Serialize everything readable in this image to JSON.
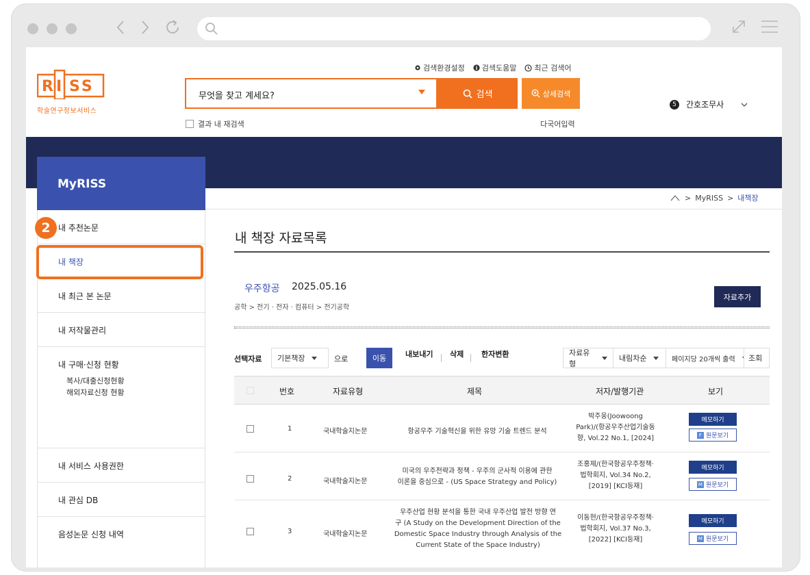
{
  "browser": {
    "url": ""
  },
  "header": {
    "logo_text": "RISS",
    "logo_caption": "학술연구정보서비스",
    "top_links": [
      "검색환경설정",
      "검색도움말",
      "최근 검색어"
    ],
    "search_placeholder": "무엇을 찾고 계세요?",
    "search_button": "검색",
    "detail_button": "상세검색",
    "result_search": "결과 내 재검색",
    "multi_lang": "다국어입력",
    "user_badge": "5",
    "user_name": "간호조무사"
  },
  "myriss": {
    "title": "MyRISS"
  },
  "breadcrumb": {
    "mid": "MyRISS",
    "current": "내책장"
  },
  "annotation": {
    "step": "2"
  },
  "sidebar": {
    "items": [
      {
        "label": "내 추천논문"
      },
      {
        "label": "내 책장"
      },
      {
        "label": "내 최근 본 논문"
      },
      {
        "label": "내 저작물관리"
      },
      {
        "label": "내 구매·신청 현황",
        "subs": [
          "복사/대출신청현황",
          "해외자료신청 현황"
        ]
      },
      {
        "label": "내 서비스 사용권한"
      },
      {
        "label": "내 관심 DB"
      },
      {
        "label": "음성논문 신청 내역"
      }
    ]
  },
  "content": {
    "title": "내 책장 자료목록",
    "shelf_name": "우주항공",
    "shelf_date": "2025.05.16",
    "shelf_category": "공학 > 전기 · 전자 · 컴퓨터 > 전기공학",
    "add_button": "자료추가"
  },
  "toolbar": {
    "label": "선택자료",
    "shelf_select": "기본책장",
    "to_text": "으로",
    "move": "이동",
    "export": "내보내기",
    "delete": "삭제",
    "hanja": "한자변환",
    "type_select": "자료유형",
    "sort_select": "내림차순",
    "per_page_select": "페이지당 20개씩 출력",
    "query": "조회"
  },
  "table": {
    "headers": [
      "번호",
      "자료유형",
      "제목",
      "저자/발행기관",
      "보기"
    ],
    "memo_label": "메모하기",
    "rows": [
      {
        "num": "1",
        "type": "국내학술지논문",
        "title": [
          "항공우주 기술혁신을 위한 유망 기술 트렌드 분석"
        ],
        "author": [
          "박주웅(Joowoong",
          "Park)/(항공우주산업기술동",
          "향, Vol.22 No.1, [2024]"
        ],
        "view_icon": "F",
        "view_label": "원문보기"
      },
      {
        "num": "2",
        "type": "국내학술지논문",
        "title": [
          "미국의 우주전략과 정책 - 우주의 군사적 이용에 관한",
          "이론을 중심으로 - (US Space Strategy and Policy)"
        ],
        "author": [
          "조홍제/(한국항공우주정책·",
          "법학회지, Vol.34 No.2,",
          "[2019] [KCI등재]"
        ],
        "view_icon": "M",
        "view_label": "원문보기"
      },
      {
        "num": "3",
        "type": "국내학술지논문",
        "title": [
          "우주산업 현황 분석을 통한 국내 우주산업 발전 방향 연",
          "구 (A Study on the Development Direction of the",
          "Domestic Space Industry through Analysis of the",
          "Current State of the Space Industry)"
        ],
        "author": [
          "이동현/(한국항공우주정책·",
          "법학회지, Vol.37 No.3,",
          "[2022] [KCI등재]"
        ],
        "view_icon": "M",
        "view_label": "원문보기"
      }
    ]
  },
  "colors": {
    "orange": "#f07020",
    "navy": "#1f2a56",
    "blue": "#3a52ae"
  }
}
